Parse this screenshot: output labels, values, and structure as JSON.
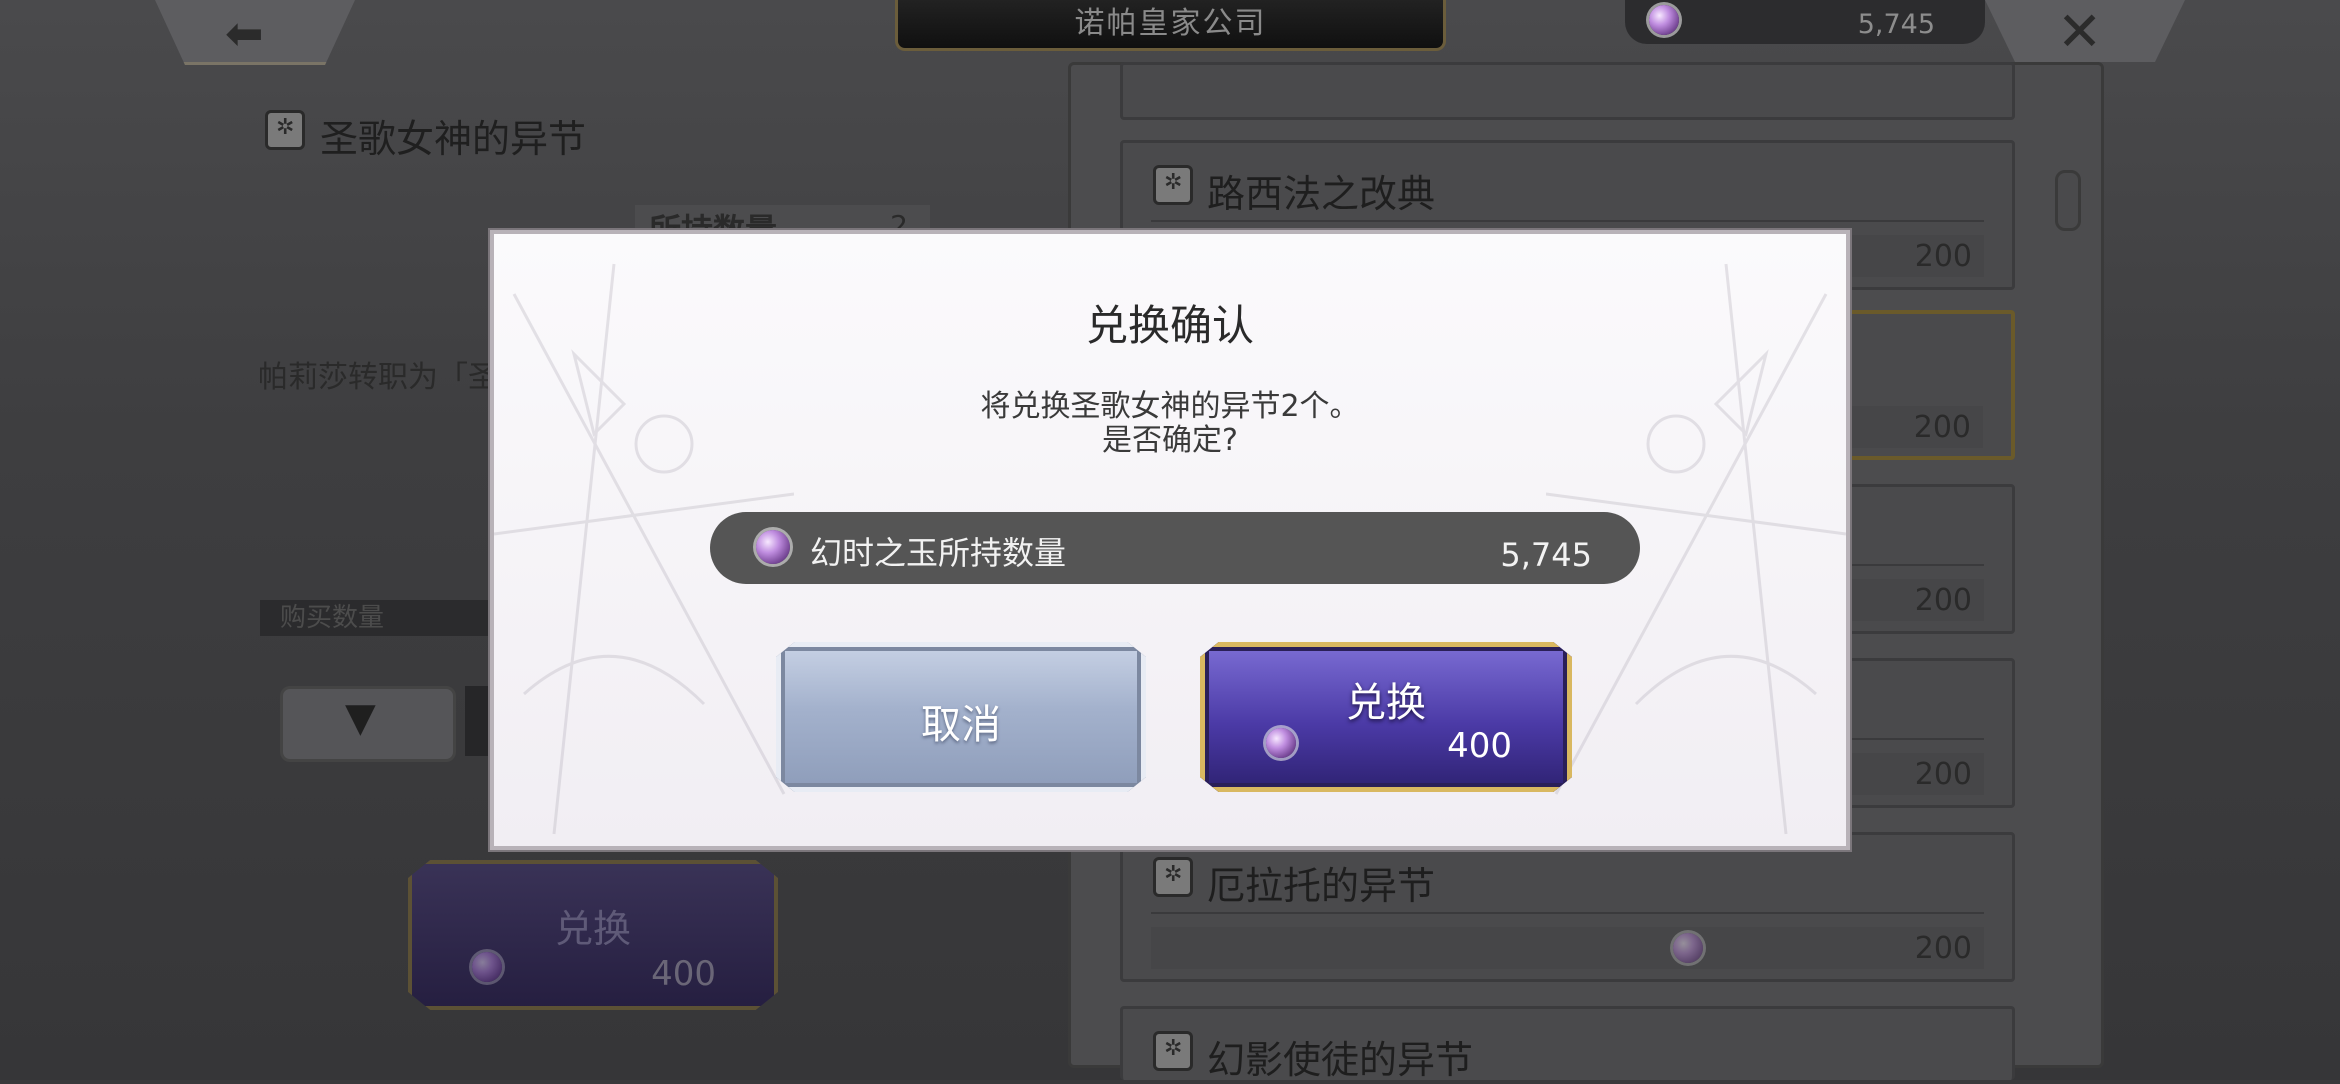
{
  "topbar": {
    "shop_title": "诺帕皇家公司",
    "currency_value": "5,745",
    "back_icon": "back-arrow-icon",
    "close_icon": "close-icon"
  },
  "left_pane": {
    "item_title": "圣歌女神的异节",
    "owned_label": "所持数量",
    "owned_value": "2",
    "description": "帕莉莎转职为「圣",
    "buy_qty_label": "购买数量",
    "exchange_label": "兑换",
    "exchange_price": "400"
  },
  "list": {
    "items": [
      {
        "name": "路西法之改典",
        "price": "200"
      },
      {
        "name": "",
        "price": "200"
      },
      {
        "name": "",
        "price": "200"
      },
      {
        "name": "",
        "price": "200"
      },
      {
        "name": "厄拉托的异节",
        "price": "200"
      },
      {
        "name": "幻影使徒的异节",
        "price": ""
      }
    ]
  },
  "dialog": {
    "title": "兑换确认",
    "message_line1": "将兑换圣歌女神的异节2个。",
    "message_line2": "是否确定?",
    "owned_label": "幻时之玉所持数量",
    "owned_value": "5,745",
    "cancel_label": "取消",
    "confirm_label": "兑换",
    "confirm_price": "400"
  },
  "colors": {
    "accent_gold": "#d9b860",
    "confirm_purple": "#4b3aa6",
    "cancel_blue": "#a3b1cc"
  }
}
